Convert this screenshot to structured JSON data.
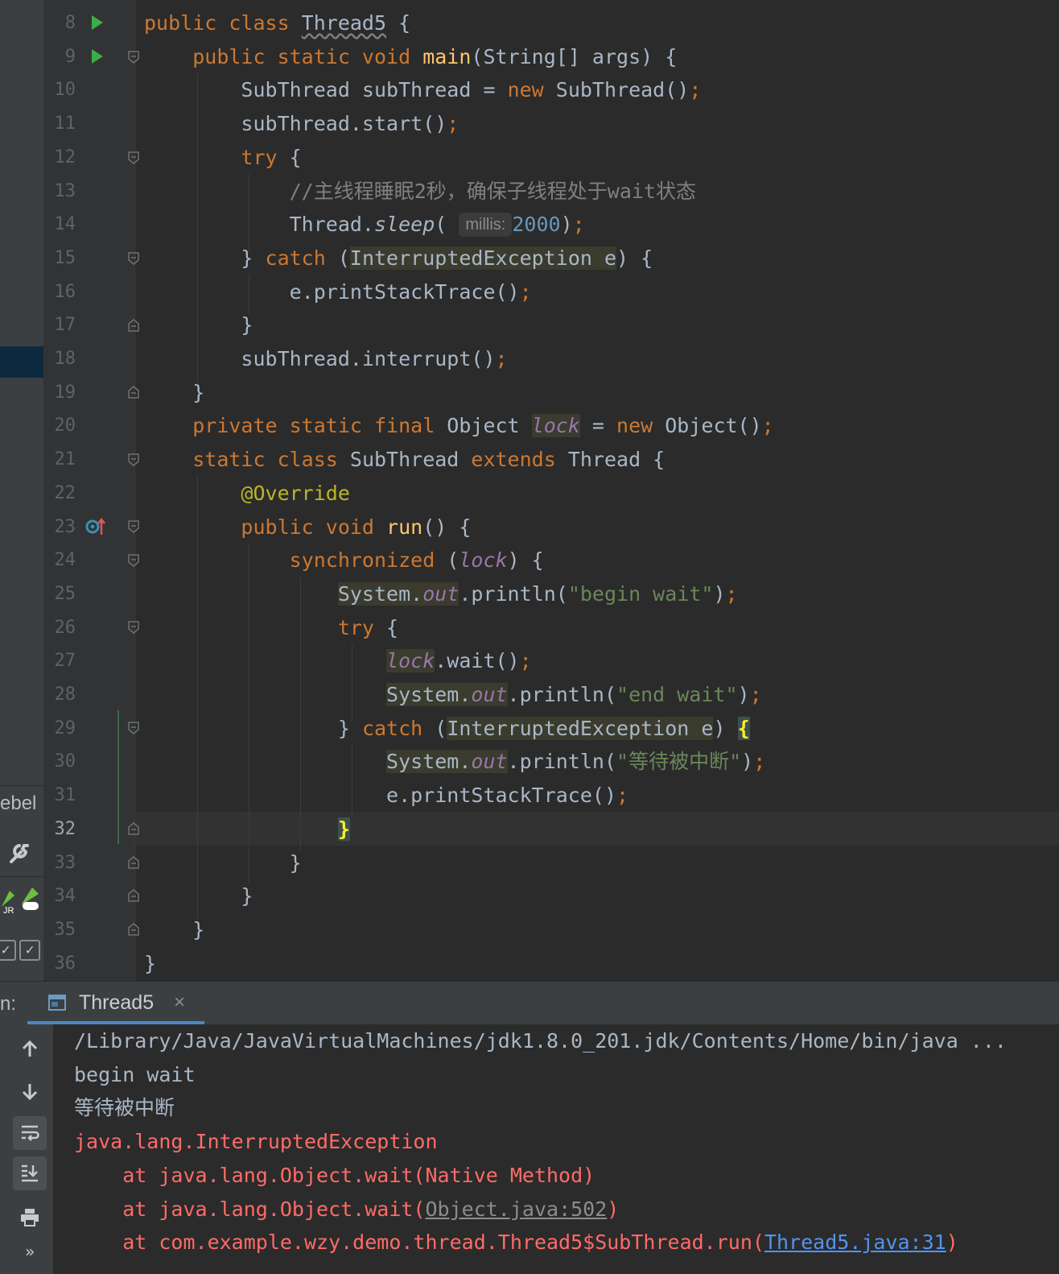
{
  "editor": {
    "line_numbers": [
      "8",
      "9",
      "10",
      "11",
      "12",
      "13",
      "14",
      "15",
      "16",
      "17",
      "18",
      "19",
      "20",
      "21",
      "22",
      "23",
      "24",
      "25",
      "26",
      "27",
      "28",
      "29",
      "30",
      "31",
      "32",
      "33",
      "34",
      "35",
      "36"
    ],
    "current_line": "32",
    "code": {
      "l8": {
        "kw1": "public class ",
        "cls": "Thread5",
        "rest": " {"
      },
      "l9": {
        "kw1": "public static void ",
        "fn": "main",
        "rest": "(String[] args) {"
      },
      "l10": {
        "a": "SubThread subThread = ",
        "kw": "new",
        "b": " SubThread()",
        "semi": ";"
      },
      "l11": {
        "a": "subThread.start()",
        "semi": ";"
      },
      "l12": {
        "kw": "try",
        "rest": " {"
      },
      "l13": {
        "comment": "//主线程睡眠2秒，确保子线程处于wait状态"
      },
      "l14": {
        "a": "Thread.",
        "fn": "sleep",
        "b": "( ",
        "hint": "millis:",
        "num": "2000",
        "c": ")",
        "semi": ";"
      },
      "l15": {
        "a": "} ",
        "kw": "catch",
        "b": " (",
        "hl": "InterruptedException e",
        "c": ") {"
      },
      "l16": {
        "a": "e.printStackTrace()",
        "semi": ";"
      },
      "l17": {
        "a": "}"
      },
      "l18": {
        "a": "subThread.interrupt()",
        "semi": ";"
      },
      "l19": {
        "a": "}"
      },
      "l20": {
        "kw": "private static final ",
        "a": "Object ",
        "fld": "lock",
        "b": " = ",
        "kw2": "new",
        "c": " Object()",
        "semi": ";"
      },
      "l21": {
        "kw": "static class ",
        "a": "SubThread ",
        "kw2": "extends",
        "b": " Thread {"
      },
      "l22": {
        "ann": "@Override"
      },
      "l23": {
        "kw": "public void ",
        "fn": "run",
        "rest": "() {"
      },
      "l24": {
        "kw": "synchronized",
        "a": " (",
        "fld": "lock",
        "b": ") {"
      },
      "l25": {
        "sys": "System.",
        "out": "out",
        "a": ".println(",
        "str": "\"begin wait\"",
        "b": ")",
        "semi": ";"
      },
      "l26": {
        "kw": "try",
        "rest": " {"
      },
      "l27": {
        "fld": "lock",
        "a": ".wait()",
        "semi": ";"
      },
      "l28": {
        "sys": "System.",
        "out": "out",
        "a": ".println(",
        "str": "\"end wait\"",
        "b": ")",
        "semi": ";"
      },
      "l29": {
        "a": "} ",
        "kw": "catch",
        "b": " (",
        "hl": "InterruptedException e",
        "c": ") ",
        "brace": "{"
      },
      "l30": {
        "sys": "System.",
        "out": "out",
        "a": ".println(",
        "str": "\"等待被中断\"",
        "b": ")",
        "semi": ";"
      },
      "l31": {
        "a": "e.printStackTrace()",
        "semi": ";"
      },
      "l32": {
        "brace": "}"
      },
      "l33": {
        "a": "}"
      },
      "l34": {
        "a": "}"
      },
      "l35": {
        "a": "}"
      },
      "l36": {
        "a": "}"
      }
    }
  },
  "left_strip": {
    "label": "ebel"
  },
  "run_panel": {
    "title": "n:",
    "tab_label": "Thread5",
    "tab_close": "×",
    "console": {
      "cmd": "/Library/Java/JavaVirtualMachines/jdk1.8.0_201.jdk/Contents/Home/bin/java ...",
      "out1": "begin wait",
      "out2": "等待被中断",
      "exc": "java.lang.InterruptedException",
      "st1": "    at java.lang.Object.wait(Native Method)",
      "st2_a": "    at java.lang.Object.wait(",
      "st2_link": "Object.java:502",
      "st2_b": ")",
      "st3_a": "    at com.example.wzy.demo.thread.Thread5$SubThread.run(",
      "st3_link": "Thread5.java:31",
      "st3_b": ")"
    },
    "toolbar": {
      "more": "»"
    }
  }
}
